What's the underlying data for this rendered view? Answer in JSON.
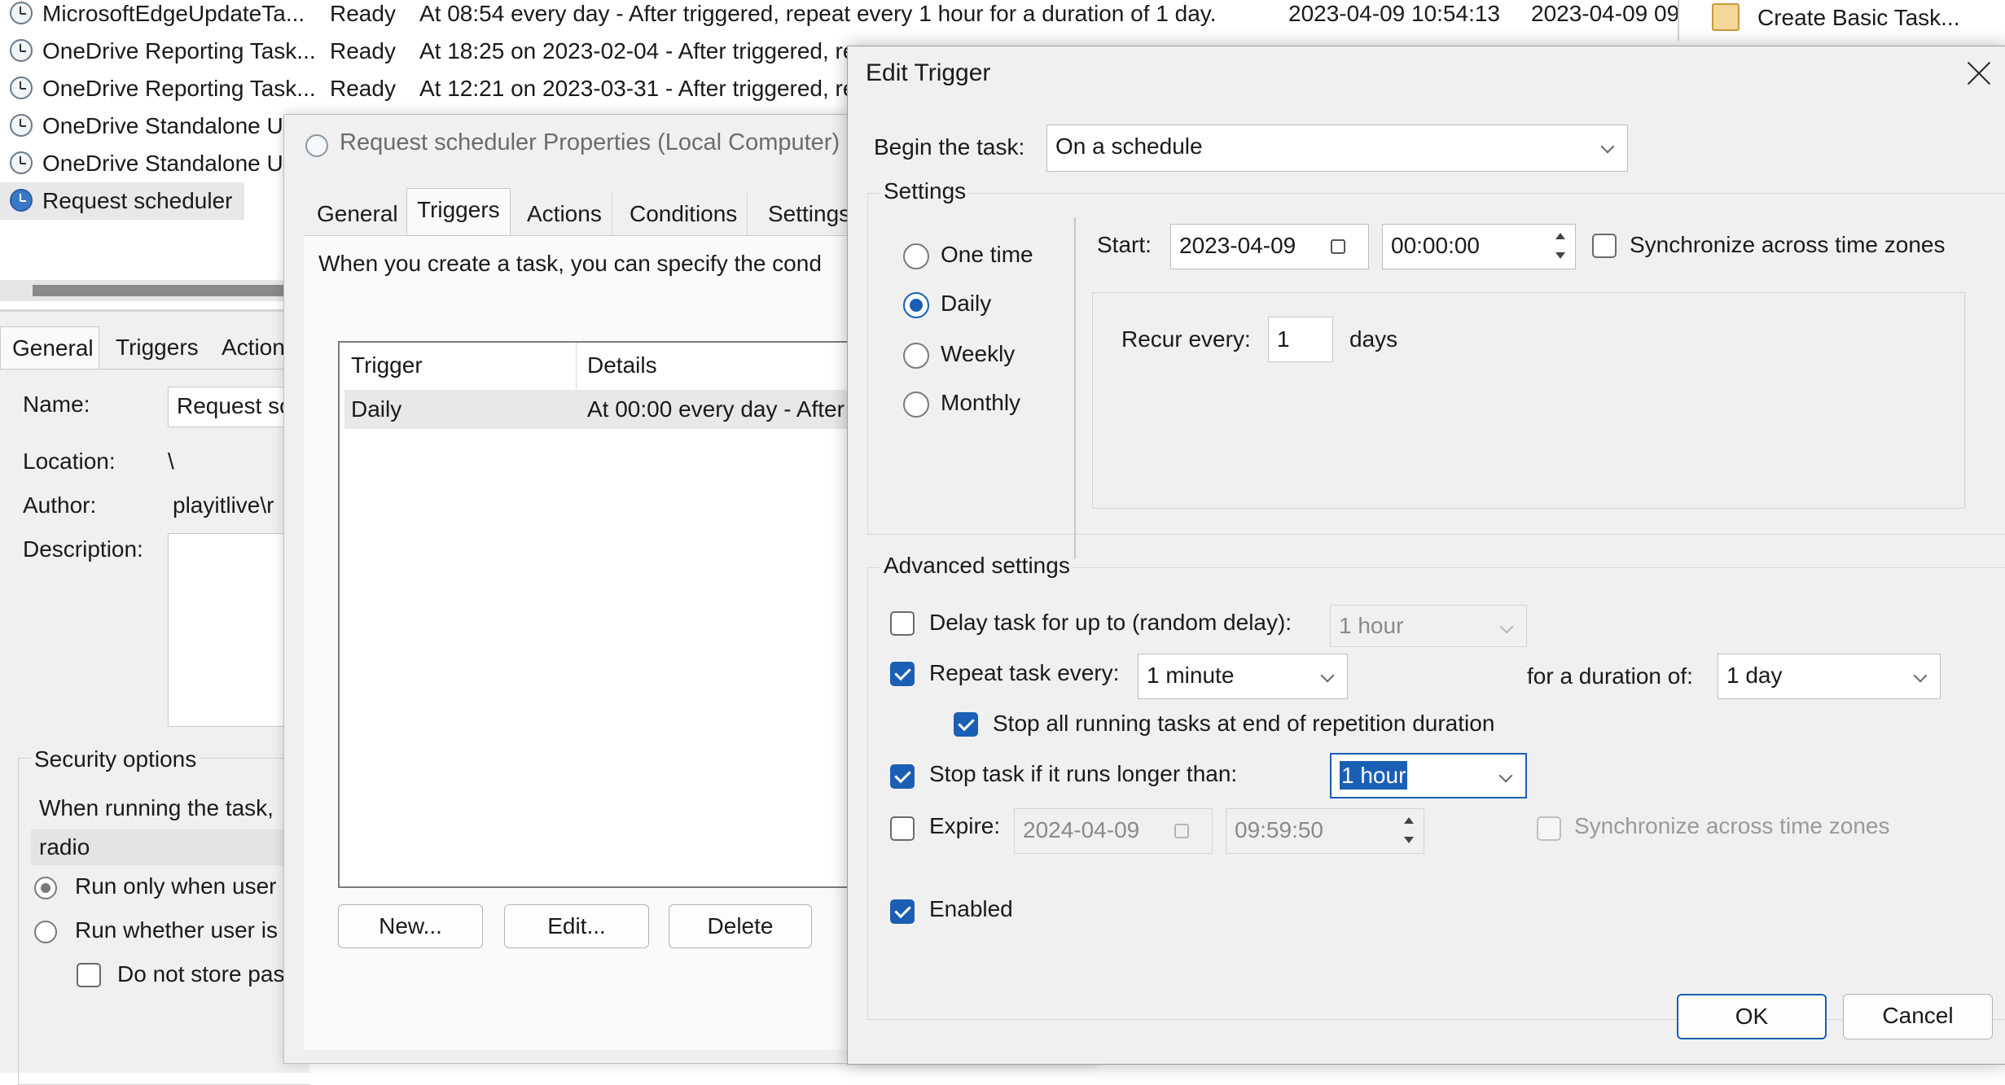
{
  "task_list": {
    "rows": [
      {
        "name": "MicrosoftEdgeUpdateTa...",
        "status": "Ready",
        "trigger": "At 08:54 every day - After triggered, repeat every 1 hour for a duration of 1 day.",
        "next_run": "2023-04-09 10:54:13",
        "last_run": "2023-04-09 09"
      },
      {
        "name": "OneDrive Reporting Task...",
        "status": "Ready",
        "trigger": "At 18:25 on 2023-02-04 - After triggered, re",
        "next_run": "",
        "last_run": ""
      },
      {
        "name": "OneDrive Reporting Task...",
        "status": "Ready",
        "trigger": "At 12:21 on 2023-03-31 - After triggered, re",
        "next_run": "",
        "last_run": ""
      },
      {
        "name": "OneDrive Standalone U",
        "status": "",
        "trigger": "",
        "next_run": "",
        "last_run": ""
      },
      {
        "name": "OneDrive Standalone U",
        "status": "",
        "trigger": "",
        "next_run": "",
        "last_run": ""
      },
      {
        "name": "Request scheduler",
        "status": "",
        "trigger": "",
        "next_run": "",
        "last_run": ""
      }
    ]
  },
  "actions_pane": {
    "create_basic_task": "Create Basic Task..."
  },
  "left_pane": {
    "tabs": [
      "General",
      "Triggers",
      "Action"
    ],
    "name_label": "Name:",
    "name_value": "Request sc",
    "location_label": "Location:",
    "location_value": "\\",
    "author_label": "Author:",
    "author_value": "playitlive\\r",
    "description_label": "Description:",
    "security_label": "Security options",
    "when_running": "When running the task,",
    "user_account": "radio",
    "run_only": "Run only when user",
    "run_whether": "Run whether user is",
    "do_not_store": "Do not store pas"
  },
  "props_dialog": {
    "title": "Request scheduler Properties (Local Computer)",
    "tabs": [
      "General",
      "Triggers",
      "Actions",
      "Conditions",
      "Settings"
    ],
    "intro": "When you create a task, you can specify the cond",
    "table": {
      "headers": [
        "Trigger",
        "Details"
      ],
      "rows": [
        {
          "trigger": "Daily",
          "details": "At 00:00 every day - After"
        }
      ]
    },
    "buttons": {
      "new": "New...",
      "edit": "Edit...",
      "delete": "Delete"
    }
  },
  "edit_trigger": {
    "title": "Edit Trigger",
    "begin_label": "Begin the task:",
    "begin_value": "On a schedule",
    "settings_label": "Settings",
    "schedule_options": [
      "One time",
      "Daily",
      "Weekly",
      "Monthly"
    ],
    "selected_schedule": "Daily",
    "start_label": "Start:",
    "start_date": "2023-04-09",
    "start_time": "00:00:00",
    "sync_label": "Synchronize across time zones",
    "recur_label": "Recur every:",
    "recur_value": "1",
    "recur_unit": "days",
    "advanced_label": "Advanced settings",
    "delay_label": "Delay task for up to (random delay):",
    "delay_value": "1 hour",
    "repeat_label": "Repeat task every:",
    "repeat_value": "1 minute",
    "duration_label": "for a duration of:",
    "duration_value": "1 day",
    "stop_all_label": "Stop all running tasks at end of repetition duration",
    "stop_longer_label": "Stop task if it runs longer than:",
    "stop_longer_value": "1 hour",
    "expire_label": "Expire:",
    "expire_date": "2024-04-09",
    "expire_time": "09:59:50",
    "expire_sync_label": "Synchronize across time zones",
    "enabled_label": "Enabled",
    "ok": "OK",
    "cancel": "Cancel"
  },
  "colors": {
    "accent": "#1a5fb4",
    "dialog_bg": "#f0f0f0",
    "selection": "#1a5fb4"
  }
}
